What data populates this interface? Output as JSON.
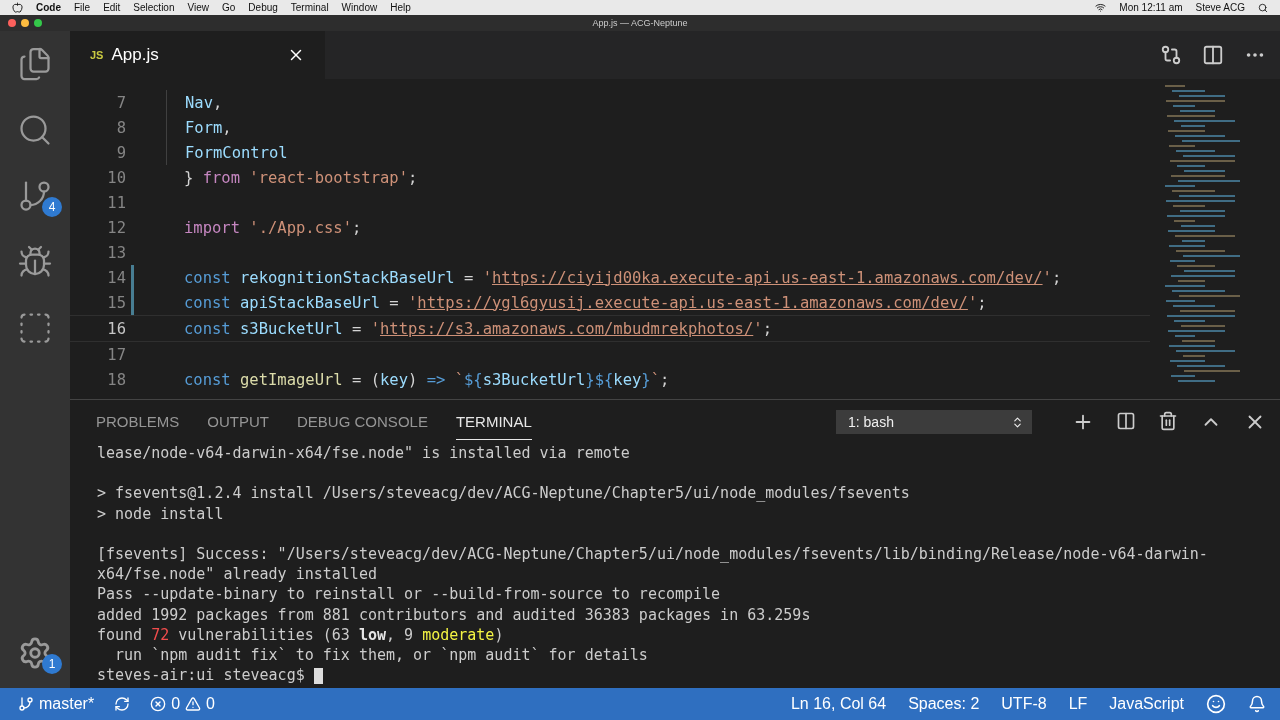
{
  "menu_bar": {
    "app": "Code",
    "items": [
      "File",
      "Edit",
      "Selection",
      "View",
      "Go",
      "Debug",
      "Terminal",
      "Window",
      "Help"
    ],
    "clock": "Mon 12:11 am",
    "user": "Steve ACG"
  },
  "window": {
    "title": "App.js — ACG-Neptune"
  },
  "activity_bar": {
    "items": [
      {
        "kind": "files",
        "selected": false
      },
      {
        "kind": "search",
        "selected": false
      },
      {
        "kind": "git",
        "selected": false,
        "badge": "4"
      },
      {
        "kind": "debug",
        "selected": false
      },
      {
        "kind": "extensions",
        "selected": false
      }
    ],
    "settings_badge": "1"
  },
  "editor_tabs": [
    {
      "lang": "JS",
      "label": "App.js",
      "selected": true
    }
  ],
  "code": [
    {
      "number": "7",
      "current": false,
      "changed": false,
      "indent": true,
      "tokens": [
        {
          "kind": "var",
          "text": "Nav"
        },
        {
          "kind": "plain",
          "text": ","
        }
      ]
    },
    {
      "number": "8",
      "current": false,
      "changed": false,
      "indent": true,
      "tokens": [
        {
          "kind": "var",
          "text": "Form"
        },
        {
          "kind": "plain",
          "text": ","
        }
      ]
    },
    {
      "number": "9",
      "current": false,
      "changed": false,
      "indent": true,
      "tokens": [
        {
          "kind": "var",
          "text": "FormControl"
        }
      ]
    },
    {
      "number": "10",
      "current": false,
      "changed": false,
      "indent": false,
      "tokens": [
        {
          "kind": "plain",
          "text": "} "
        },
        {
          "kind": "import",
          "text": "from "
        },
        {
          "kind": "string",
          "text": "'react-bootstrap'"
        },
        {
          "kind": "plain",
          "text": ";"
        }
      ]
    },
    {
      "number": "11",
      "current": false,
      "changed": false,
      "indent": false
    },
    {
      "number": "12",
      "current": false,
      "changed": false,
      "indent": false,
      "tokens": [
        {
          "kind": "import",
          "text": "import "
        },
        {
          "kind": "string",
          "text": "'./App.css'"
        },
        {
          "kind": "plain",
          "text": ";"
        }
      ]
    },
    {
      "number": "13",
      "current": false,
      "changed": false,
      "indent": false
    },
    {
      "number": "14",
      "current": false,
      "changed": true,
      "indent": false,
      "tokens": [
        {
          "kind": "keyword",
          "text": "const "
        },
        {
          "kind": "var",
          "text": "rekognitionStackBaseUrl"
        },
        {
          "kind": "plain",
          "text": " = "
        },
        {
          "kind": "string",
          "text": "'"
        },
        {
          "kind": "link",
          "text": "https://ciyijd00ka.execute-api.us-east-1.amazonaws.com/dev/"
        },
        {
          "kind": "string",
          "text": "'"
        },
        {
          "kind": "plain",
          "text": ";"
        }
      ]
    },
    {
      "number": "15",
      "current": false,
      "changed": true,
      "indent": false,
      "tokens": [
        {
          "kind": "keyword",
          "text": "const "
        },
        {
          "kind": "var",
          "text": "apiStackBaseUrl"
        },
        {
          "kind": "plain",
          "text": " = "
        },
        {
          "kind": "string",
          "text": "'"
        },
        {
          "kind": "link",
          "text": "https://ygl6gyusij.execute-api.us-east-1.amazonaws.com/dev/"
        },
        {
          "kind": "string",
          "text": "'"
        },
        {
          "kind": "plain",
          "text": ";"
        }
      ]
    },
    {
      "number": "16",
      "current": true,
      "changed": false,
      "indent": false,
      "tokens": [
        {
          "kind": "keyword",
          "text": "const "
        },
        {
          "kind": "var",
          "text": "s3BucketUrl"
        },
        {
          "kind": "plain",
          "text": " = "
        },
        {
          "kind": "string",
          "text": "'"
        },
        {
          "kind": "link",
          "text": "https://s3.amazonaws.com/mbudmrekphotos/"
        },
        {
          "kind": "string",
          "text": "'"
        },
        {
          "kind": "plain",
          "text": ";"
        }
      ]
    },
    {
      "number": "17",
      "current": false,
      "changed": false,
      "indent": false
    },
    {
      "number": "18",
      "current": false,
      "changed": false,
      "indent": false,
      "tokens": [
        {
          "kind": "keyword",
          "text": "const "
        },
        {
          "kind": "func",
          "text": "getImageUrl"
        },
        {
          "kind": "plain",
          "text": " = ("
        },
        {
          "kind": "var",
          "text": "key"
        },
        {
          "kind": "plain",
          "text": ") "
        },
        {
          "kind": "keyword",
          "text": "=> "
        },
        {
          "kind": "string",
          "text": "`"
        },
        {
          "kind": "keyword",
          "text": "${"
        },
        {
          "kind": "var",
          "text": "s3BucketUrl"
        },
        {
          "kind": "keyword",
          "text": "}${"
        },
        {
          "kind": "var",
          "text": "key"
        },
        {
          "kind": "keyword",
          "text": "}"
        },
        {
          "kind": "string",
          "text": "`"
        },
        {
          "kind": "plain",
          "text": ";"
        }
      ]
    }
  ],
  "panel": {
    "tabs": [
      {
        "label": "PROBLEMS",
        "selected": false
      },
      {
        "label": "OUTPUT",
        "selected": false
      },
      {
        "label": "DEBUG CONSOLE",
        "selected": false
      },
      {
        "label": "TERMINAL",
        "selected": true
      }
    ],
    "terminal_select": "1: bash"
  },
  "terminal": [
    {
      "cursor": false,
      "segments": [
        {
          "kind": "plain",
          "text": "lease/node-v64-darwin-x64/fse.node\" is installed via remote"
        }
      ]
    },
    {
      "cursor": false
    },
    {
      "cursor": false,
      "segments": [
        {
          "kind": "plain",
          "text": "> fsevents@1.2.4 install /Users/steveacg/dev/ACG-Neptune/Chapter5/ui/node_modules/fsevents"
        }
      ]
    },
    {
      "cursor": false,
      "segments": [
        {
          "kind": "plain",
          "text": "> node install"
        }
      ]
    },
    {
      "cursor": false
    },
    {
      "cursor": false,
      "segments": [
        {
          "kind": "plain",
          "text": "[fsevents] Success: \"/Users/steveacg/dev/ACG-Neptune/Chapter5/ui/node_modules/fsevents/lib/binding/Release/node-v64-darwin-"
        }
      ]
    },
    {
      "cursor": false,
      "segments": [
        {
          "kind": "plain",
          "text": "x64/fse.node\" already installed"
        }
      ]
    },
    {
      "cursor": false,
      "segments": [
        {
          "kind": "plain",
          "text": "Pass --update-binary to reinstall or --build-from-source to recompile"
        }
      ]
    },
    {
      "cursor": false,
      "segments": [
        {
          "kind": "plain",
          "text": "added 1992 packages from 881 contributors and audited 36383 packages in 63.259s"
        }
      ]
    },
    {
      "cursor": false,
      "segments": [
        {
          "kind": "plain",
          "text": "found "
        },
        {
          "kind": "red",
          "text": "72"
        },
        {
          "kind": "plain",
          "text": " vulnerabilities (63 "
        },
        {
          "kind": "bold",
          "text": "low"
        },
        {
          "kind": "plain",
          "text": ", 9 "
        },
        {
          "kind": "yellow",
          "text": "moderate"
        },
        {
          "kind": "plain",
          "text": ")"
        }
      ]
    },
    {
      "cursor": false,
      "segments": [
        {
          "kind": "plain",
          "text": "  run `npm audit fix` to fix them, or `npm audit` for details"
        }
      ]
    },
    {
      "cursor": true,
      "segments": [
        {
          "kind": "plain",
          "text": "steves-air:ui steveacg$"
        }
      ]
    }
  ],
  "status_bar": {
    "branch": "master*",
    "errors": "0",
    "warnings": "0",
    "position": "Ln 16, Col 64",
    "spaces": "Spaces: 2",
    "encoding": "UTF-8",
    "eol": "LF",
    "language": "JavaScript"
  }
}
